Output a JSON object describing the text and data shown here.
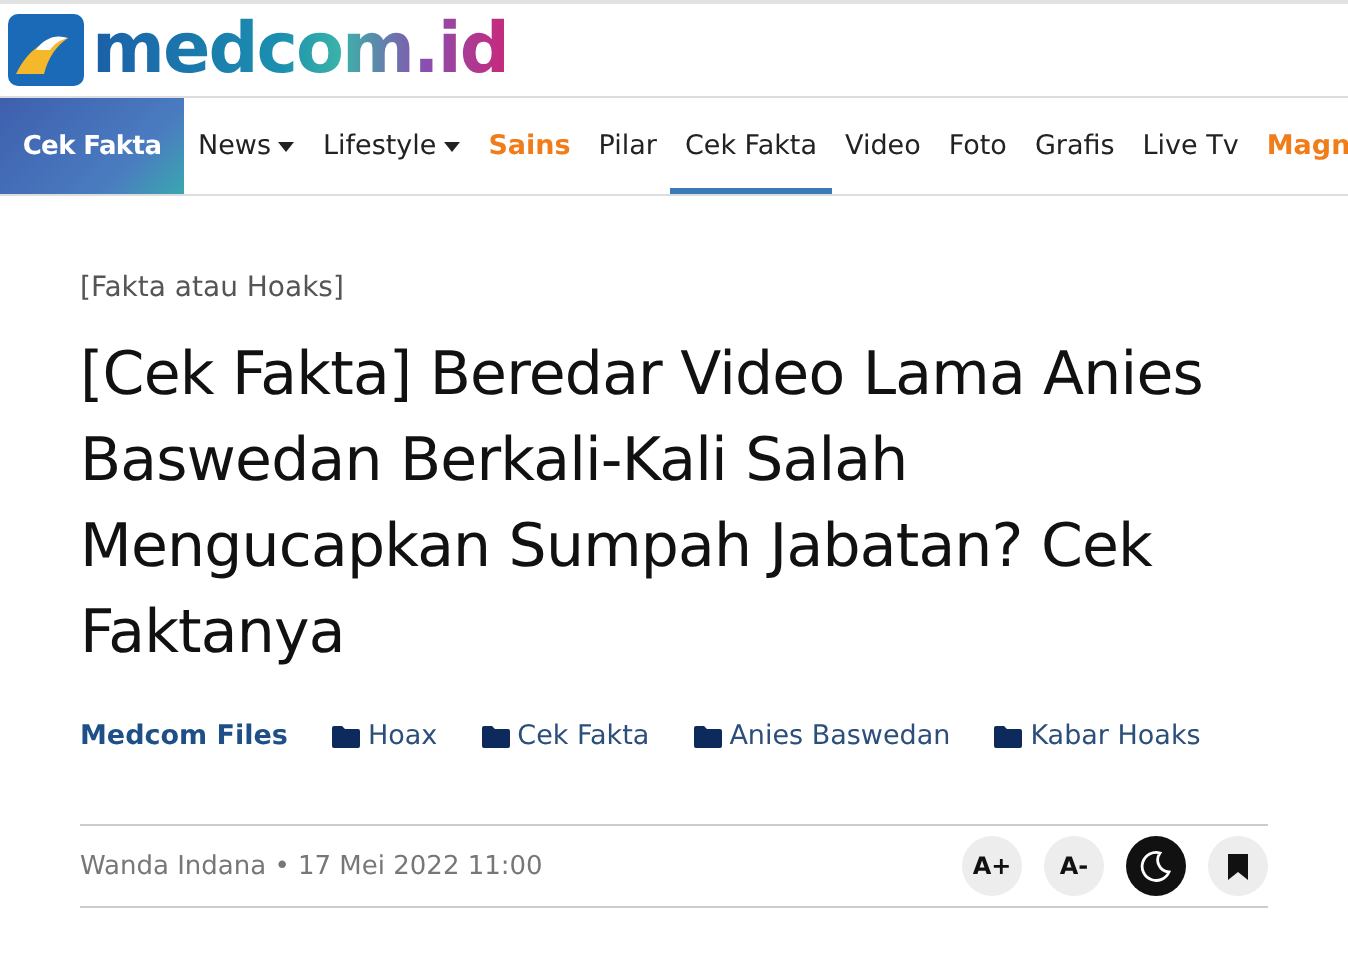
{
  "logo": {
    "text": "medcom.id"
  },
  "section_badge": "Cek Fakta",
  "nav": [
    {
      "label": "News",
      "has_menu": true,
      "selected": false,
      "color": "#222222"
    },
    {
      "label": "Lifestyle",
      "has_menu": true,
      "selected": false,
      "color": "#222222"
    },
    {
      "label": "Sains",
      "has_menu": false,
      "selected": false,
      "color": "#f07d1a"
    },
    {
      "label": "Pilar",
      "has_menu": false,
      "selected": false,
      "color": "#222222"
    },
    {
      "label": "Cek Fakta",
      "has_menu": false,
      "selected": true,
      "color": "#222222"
    },
    {
      "label": "Video",
      "has_menu": false,
      "selected": false,
      "color": "#222222"
    },
    {
      "label": "Foto",
      "has_menu": false,
      "selected": false,
      "color": "#222222"
    },
    {
      "label": "Grafis",
      "has_menu": false,
      "selected": false,
      "color": "#222222"
    },
    {
      "label": "Live Tv",
      "has_menu": false,
      "selected": false,
      "color": "#222222"
    },
    {
      "label": "Magn",
      "has_menu": false,
      "selected": false,
      "color": "#f07d1a"
    }
  ],
  "article": {
    "kicker": "[Fakta atau Hoaks]",
    "title": "[Cek Fakta] Beredar Video Lama Anies Baswedan Berkali-Kali Salah Mengucapkan Sumpah Jabatan? Cek Faktanya",
    "source": "Medcom Files",
    "tags": [
      "Hoax",
      "Cek Fakta",
      "Anies Baswedan",
      "Kabar Hoaks"
    ],
    "byline": "Wanda Indana • 17 Mei 2022 11:00",
    "tools": [
      {
        "kind": "text",
        "label": "A+",
        "dark": false
      },
      {
        "kind": "text",
        "label": "A-",
        "dark": false
      },
      {
        "kind": "moon",
        "dark": true
      },
      {
        "kind": "bookmark",
        "dark": false
      }
    ]
  }
}
